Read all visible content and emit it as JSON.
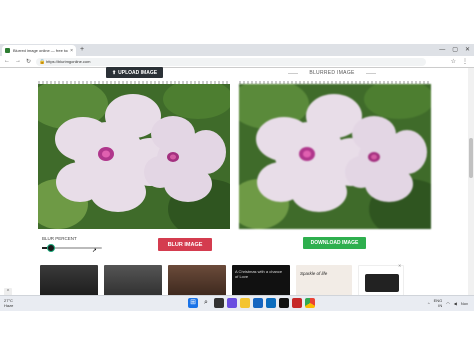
{
  "browser": {
    "tab_title": "Blurred image online — free tool",
    "tab_close": "×",
    "new_tab": "+",
    "window_controls": [
      "—",
      "▢",
      "✕"
    ],
    "url": "https://blurimgonline.com",
    "nav_glyphs": [
      "←",
      "→",
      "↻"
    ],
    "right_glyphs": [
      "☆",
      "⋮"
    ]
  },
  "page": {
    "upload_label": "UPLOAD IMAGE",
    "upload_icon": "⬆",
    "blurred_label": "BLURRED IMAGE",
    "blur_percent_label": "BLUR PERCENT",
    "blur_percent_value": 0.08,
    "blur_button": "BLUR IMAGE",
    "download_button": "DOWNLOAD IMAGE",
    "scroll_up": "^"
  },
  "ads": {
    "tile_text_1": "A Christmas with a chance of Love",
    "tile_text_2": "Sparkle of life",
    "close": "✕"
  },
  "taskbar": {
    "weather_temp": "27°C",
    "weather_desc": "Haze",
    "tray_lang": "ENG",
    "tray_region": "IN",
    "tray_notify": "Nov"
  },
  "colors": {
    "upload_bg": "#2b3137",
    "blur_bg": "#d43c4f",
    "download_bg": "#2eaf4e",
    "slider_accent": "#19a87a"
  }
}
